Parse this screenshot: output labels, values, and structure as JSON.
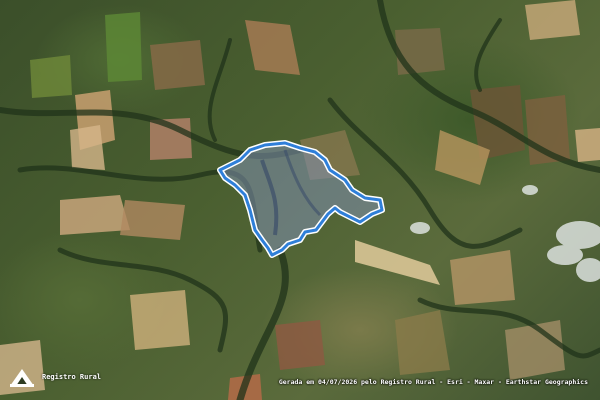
{
  "map": {
    "basemap": "satellite imagery",
    "boundary_color": "#2f7fd9",
    "boundary_halo_color": "#ffffff",
    "fill_color": "#7f8fb0"
  },
  "branding": {
    "logo": "registro-rural-logo",
    "label": "Registro Rural"
  },
  "attribution": {
    "text": "Gerada em 04/07/2026 pelo Registro Rural - Esri - Maxar - Earthstar Geographics"
  }
}
